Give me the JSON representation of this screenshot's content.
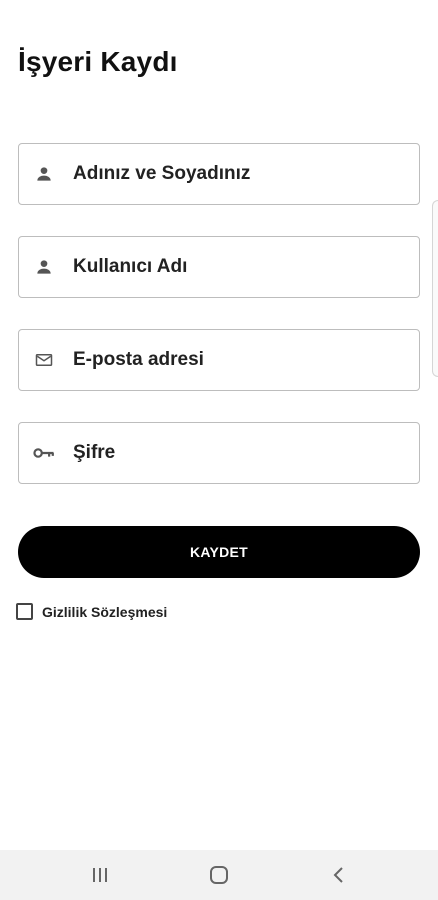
{
  "page": {
    "title": "İşyeri Kaydı"
  },
  "form": {
    "fields": [
      {
        "placeholder": "Adınız ve Soyadınız",
        "icon": "person-icon",
        "type": "text"
      },
      {
        "placeholder": "Kullanıcı Adı",
        "icon": "person-icon",
        "type": "text"
      },
      {
        "placeholder": "E-posta adresi",
        "icon": "mail-icon",
        "type": "email"
      },
      {
        "placeholder": "Şifre",
        "icon": "key-icon",
        "type": "password"
      }
    ],
    "save_label": "KAYDET",
    "privacy_label": "Gizlilik Sözleşmesi",
    "privacy_checked": false
  },
  "navbar": {
    "buttons": [
      "recent-apps-icon",
      "home-icon",
      "back-icon"
    ]
  },
  "colors": {
    "button_bg": "#000000",
    "button_text": "#ffffff",
    "field_border": "#bdbdbd",
    "navbar_bg": "#f2f2f2"
  }
}
